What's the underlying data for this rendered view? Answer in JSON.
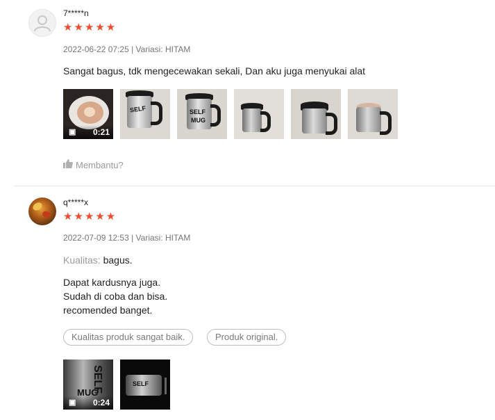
{
  "reviews": [
    {
      "username": "7*****n",
      "stars": "★★★★★",
      "meta": "2022-06-22 07:25 | Variasi: HITAM",
      "comment": "Sangat bagus, tdk mengecewakan sekali, Dan aku juga menyukai alat",
      "video_duration": "0:21",
      "helpful_label": "Membantu?"
    },
    {
      "username": "q*****x",
      "stars": "★★★★★",
      "meta": "2022-07-09 12:53 | Variasi: HITAM",
      "quality_label": "Kualitas:",
      "quality_value": "bagus.",
      "lines": [
        "Dapat kardusnya juga.",
        "Sudah di coba dan bisa.",
        "recomended banget."
      ],
      "tags": [
        "Kualitas produk sangat baik.",
        "Produk original."
      ],
      "video_duration": "0:24"
    }
  ],
  "icons": {
    "star_color": "#ee4d2d",
    "video": "camera-icon",
    "helpful": "thumbs-up-icon"
  }
}
